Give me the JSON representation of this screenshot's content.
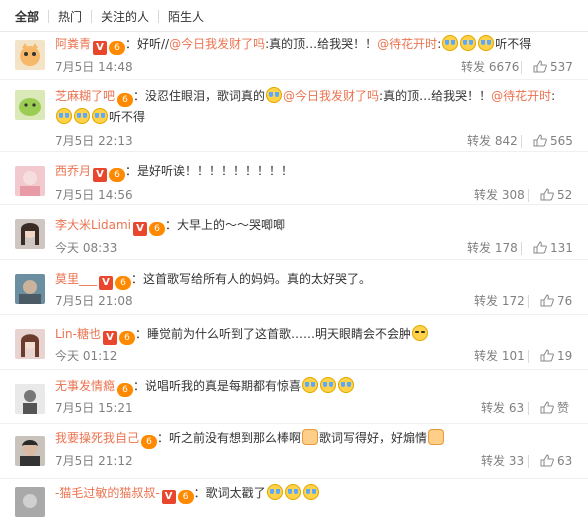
{
  "tabs": [
    {
      "label": "全部",
      "active": true
    },
    {
      "label": "热门",
      "active": false
    },
    {
      "label": "关注的人",
      "active": false
    },
    {
      "label": "陌生人",
      "active": false
    }
  ],
  "colors": {
    "accent": "#eb7350",
    "meta": "#808080",
    "vip": "#e8472e"
  },
  "comments": [
    {
      "user": "阿粪青",
      "pre": "：好听//",
      "m1": "@今日我发财了吗",
      "mid": ":真的顶…给我哭！！",
      "m2": "@待花开时",
      "post": ":",
      "post2": "听不得",
      "time": "7月5日 14:48",
      "repost": "转发 6676",
      "likes": "537"
    },
    {
      "user": "芝麻糊了吧",
      "pre": "：没忍住眼泪，歌词真的",
      "m1": "@今日我发财了吗",
      "mid": ":真的顶…给我哭！！",
      "m2": "@待花开时",
      "post": ":",
      "line2": "听不得",
      "time": "7月5日 22:13",
      "repost": "转发 842",
      "likes": "565"
    },
    {
      "user": "西乔月",
      "text": "：是好听诶！！！！！！！！！",
      "time": "7月5日 14:56",
      "repost": "转发 308",
      "likes": "52"
    },
    {
      "user": "李大米Lidami",
      "text": "：大早上的～～哭唧唧",
      "time": "今天 08:33",
      "repost": "转发 178",
      "likes": "131"
    },
    {
      "user": "莫里___",
      "text": "：这首歌写给所有人的妈妈。真的太好哭了。",
      "time": "7月5日 21:08",
      "repost": "转发 172",
      "likes": "76"
    },
    {
      "user": "Lin-糖也",
      "text": "：睡觉前为什么听到了这首歌……明天眼睛会不会肿",
      "time": "今天 01:12",
      "repost": "转发 101",
      "likes": "19"
    },
    {
      "user": "无事发情瘾",
      "text": "：说唱听我的真是每期都有惊喜",
      "time": "7月5日 15:21",
      "repost": "转发 63",
      "likes": "赞"
    },
    {
      "user": "我要操死我自己",
      "text": "：听之前没有想到那么棒啊",
      "text2": "歌词写得好，好煽情",
      "time": "7月5日 21:12",
      "repost": "转发 33",
      "likes": "63"
    },
    {
      "user": "-猫毛过敏的猫叔叔-",
      "text": "：歌词太戳了",
      "time": "",
      "repost": "",
      "likes": ""
    }
  ]
}
